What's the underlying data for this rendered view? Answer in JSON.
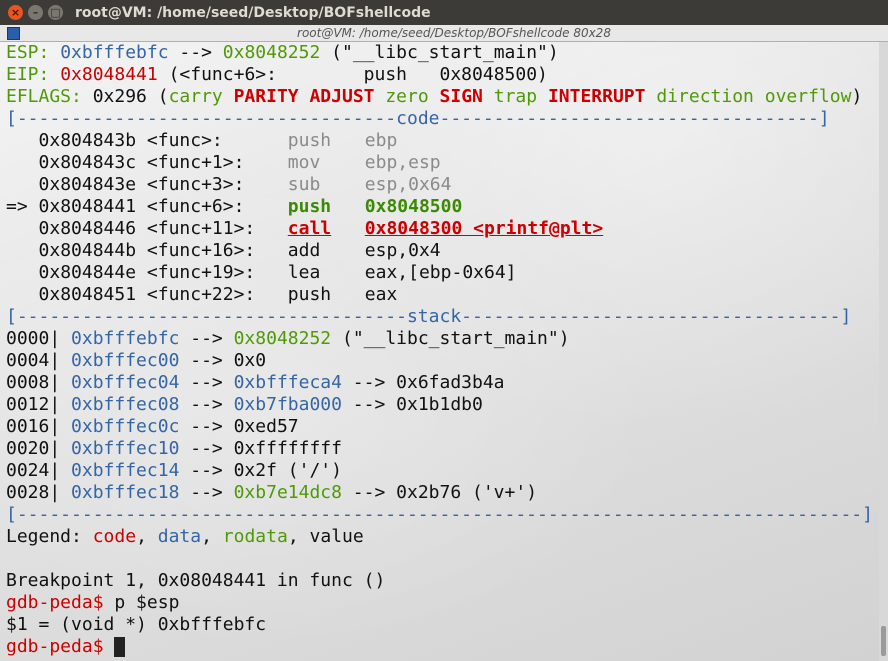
{
  "window": {
    "title": "root@VM: /home/seed/Desktop/BOFshellcode",
    "close_glyph": "×",
    "min_glyph": "–",
    "max_glyph": "□",
    "terminal_header": "root@VM: /home/seed/Desktop/BOFshellcode 80x28"
  },
  "registers": {
    "esp_label": "ESP:",
    "esp_value": "0xbfffebfc",
    "esp_arrow": " --> ",
    "esp_target": "0x8048252",
    "esp_desc": " (\"__libc_start_main\")",
    "eip_label": "EIP:",
    "eip_value": "0x8048441",
    "eip_desc": " (<func+6>:        push   0x8048500)",
    "eflags_label": "EFLAGS:",
    "eflags_value": " 0x296 (",
    "flags": [
      {
        "text": "carry",
        "active": false
      },
      {
        "text": "PARITY",
        "active": true
      },
      {
        "text": "ADJUST",
        "active": true
      },
      {
        "text": "zero",
        "active": false
      },
      {
        "text": "SIGN",
        "active": true
      },
      {
        "text": "trap",
        "active": false
      },
      {
        "text": "INTERRUPT",
        "active": true
      },
      {
        "text": "direction",
        "active": false
      },
      {
        "text": "overflow",
        "active": false
      }
    ],
    "eflags_close": ")"
  },
  "code_section": {
    "divider_left": "[-----------------------------------",
    "label": "code",
    "divider_right": "-----------------------------------]",
    "lines": [
      {
        "marker": "   ",
        "addr": "0x804843b",
        "sym": " <func>:      ",
        "op": "push",
        "args": "ebp",
        "state": "past"
      },
      {
        "marker": "   ",
        "addr": "0x804843c",
        "sym": " <func+1>:    ",
        "op": "mov",
        "args": "ebp,esp",
        "state": "past"
      },
      {
        "marker": "   ",
        "addr": "0x804843e",
        "sym": " <func+3>:    ",
        "op": "sub",
        "args": "esp,0x64",
        "state": "past"
      },
      {
        "marker": "=> ",
        "addr": "0x8048441",
        "sym": " <func+6>:    ",
        "op": "push",
        "args": "0x8048500",
        "state": "current"
      },
      {
        "marker": "   ",
        "addr": "0x8048446",
        "sym": " <func+11>:   ",
        "op": "call",
        "args": "0x8048300 <printf@plt>",
        "state": "call"
      },
      {
        "marker": "   ",
        "addr": "0x804844b",
        "sym": " <func+16>:   ",
        "op": "add",
        "args": "esp,0x4",
        "state": "future"
      },
      {
        "marker": "   ",
        "addr": "0x804844e",
        "sym": " <func+19>:   ",
        "op": "lea",
        "args": "eax,[ebp-0x64]",
        "state": "future"
      },
      {
        "marker": "   ",
        "addr": "0x8048451",
        "sym": " <func+22>:   ",
        "op": "push",
        "args": "eax",
        "state": "future"
      }
    ]
  },
  "stack_section": {
    "divider_left": "[------------------------------------",
    "label": "stack",
    "divider_right": "-----------------------------------]",
    "rows": [
      {
        "offset": "0000|",
        "addr": "0xbfffebfc",
        "arrow": " --> ",
        "val": "0x8048252",
        "val_kind": "code",
        "rest": " (\"__libc_start_main\")"
      },
      {
        "offset": "0004|",
        "addr": "0xbfffec00",
        "arrow": " --> ",
        "val": "0x0",
        "val_kind": "value",
        "rest": ""
      },
      {
        "offset": "0008|",
        "addr": "0xbfffec04",
        "arrow": " --> ",
        "val": "0xbfffeca4",
        "val_kind": "data",
        "rest": " --> 0x6fad3b4a"
      },
      {
        "offset": "0012|",
        "addr": "0xbfffec08",
        "arrow": " --> ",
        "val": "0xb7fba000",
        "val_kind": "data",
        "rest": " --> 0x1b1db0"
      },
      {
        "offset": "0016|",
        "addr": "0xbfffec0c",
        "arrow": " --> ",
        "val": "0xed57",
        "val_kind": "value",
        "rest": ""
      },
      {
        "offset": "0020|",
        "addr": "0xbfffec10",
        "arrow": " --> ",
        "val": "0xffffffff",
        "val_kind": "value",
        "rest": ""
      },
      {
        "offset": "0024|",
        "addr": "0xbfffec14",
        "arrow": " --> ",
        "val": "0x2f ('/')",
        "val_kind": "value",
        "rest": ""
      },
      {
        "offset": "0028|",
        "addr": "0xbfffec18",
        "arrow": " --> ",
        "val": "0xb7e14dc8",
        "val_kind": "code",
        "rest": " --> 0x2b76 ('v+')"
      }
    ]
  },
  "bottom_divider": "[------------------------------------------------------------------------------]",
  "legend": {
    "prefix": "Legend: ",
    "code": "code",
    "sep1": ", ",
    "data": "data",
    "sep2": ", ",
    "rodata": "rodata",
    "sep3": ", ",
    "value": "value"
  },
  "console": {
    "breakpoint": "Breakpoint 1, 0x08048441 in func ()",
    "prompt": "gdb-peda$",
    "cmd1": " p $esp",
    "result": "$1 = (void *) 0xbfffebfc",
    "prompt2": "gdb-peda$",
    "cmd2": " "
  },
  "colors": {
    "titlebar": "#3c3b37",
    "close_button": "#e95420",
    "green": "#4e9a06",
    "red": "#cc0000",
    "blue": "#3465a4"
  }
}
